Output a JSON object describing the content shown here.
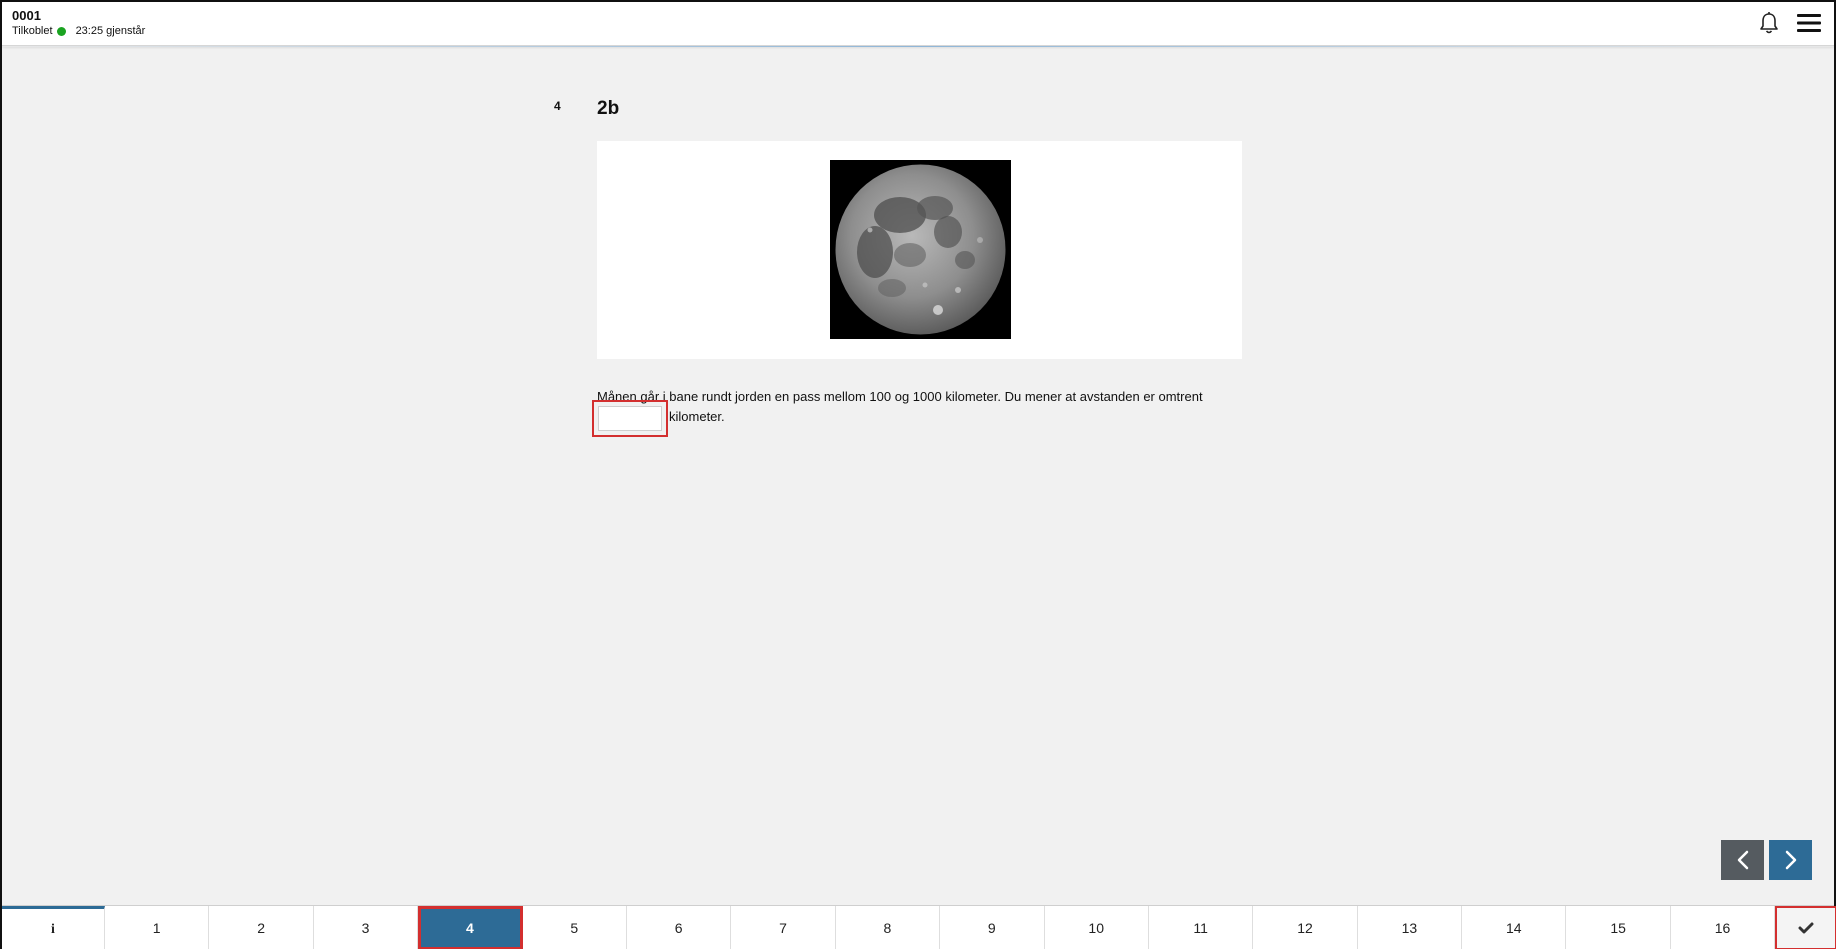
{
  "header": {
    "candidate_id": "0001",
    "connection_status": "Tilkoblet",
    "connection_color": "#1aa321",
    "time_remaining": "23:25 gjenstår",
    "icons": [
      "bell-icon",
      "hamburger-menu-icon"
    ]
  },
  "question": {
    "number": "4",
    "title": "2b",
    "image_subject": "moon-image",
    "text_before": "Månen går i bane rundt jorden en pass mellom 100 og 1000 kilometer. Du mener at avstanden er omtrent",
    "answer_value": "",
    "answer_placeholder": "",
    "text_after": "kilometer."
  },
  "navigation": {
    "prev_icon": "chevron-left-icon",
    "next_icon": "chevron-right-icon",
    "info_label": "i",
    "pages": [
      "1",
      "2",
      "3",
      "4",
      "5",
      "6",
      "7",
      "8",
      "9",
      "10",
      "11",
      "12",
      "13",
      "14",
      "15",
      "16"
    ],
    "active_page": "4",
    "finish_icon": "checkmark-icon"
  },
  "colors": {
    "accent": "#2d6b96",
    "highlight_border": "#d32f2f",
    "background": "#f1f1f1"
  }
}
